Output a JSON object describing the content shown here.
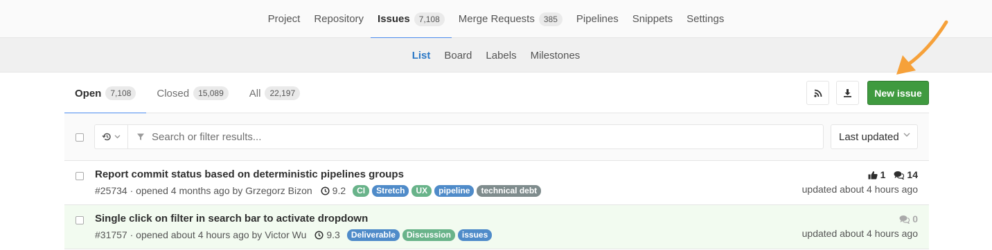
{
  "nav": {
    "tabs": [
      {
        "label": "Project"
      },
      {
        "label": "Repository"
      },
      {
        "label": "Issues",
        "count": "7,108"
      },
      {
        "label": "Merge Requests",
        "count": "385"
      },
      {
        "label": "Pipelines"
      },
      {
        "label": "Snippets"
      },
      {
        "label": "Settings"
      }
    ],
    "active": "Issues"
  },
  "subnav": {
    "tabs": [
      "List",
      "Board",
      "Labels",
      "Milestones"
    ],
    "active": "List"
  },
  "state_tabs": {
    "open": {
      "label": "Open",
      "count": "7,108"
    },
    "closed": {
      "label": "Closed",
      "count": "15,089"
    },
    "all": {
      "label": "All",
      "count": "22,197"
    }
  },
  "toolbar": {
    "rss_icon": "rss-icon",
    "download_icon": "download-icon",
    "new_issue_label": "New issue"
  },
  "filter": {
    "search_placeholder": "Search or filter results...",
    "sort_value": "Last updated"
  },
  "issues": [
    {
      "title": "Report commit status based on deterministic pipelines groups",
      "ref": "#25734",
      "opened": "· opened 4 months ago by",
      "author": "Grzegorz Bizon",
      "milestone": "9.2",
      "labels": [
        {
          "text": "CI",
          "color": "#69b38a"
        },
        {
          "text": "Stretch",
          "color": "#4f8bc9"
        },
        {
          "text": "UX",
          "color": "#69b38a"
        },
        {
          "text": "pipeline",
          "color": "#4f8bc9"
        },
        {
          "text": "technical debt",
          "color": "#7f8c8d"
        }
      ],
      "upvotes": "1",
      "comments": "14",
      "updated": "updated about 4 hours ago"
    },
    {
      "title": "Single click on filter in search bar to activate dropdown",
      "ref": "#31757",
      "opened": "· opened about 4 hours ago by",
      "author": "Victor Wu",
      "milestone": "9.3",
      "labels": [
        {
          "text": "Deliverable",
          "color": "#4f8bc9"
        },
        {
          "text": "Discussion",
          "color": "#69b38a"
        },
        {
          "text": "issues",
          "color": "#4f8bc9"
        }
      ],
      "comments": "0",
      "updated": "updated about 4 hours ago"
    }
  ],
  "colors": {
    "accent": "#4a8bee",
    "new_button": "#3f9a3f",
    "annotation_arrow": "#f6a13a"
  }
}
